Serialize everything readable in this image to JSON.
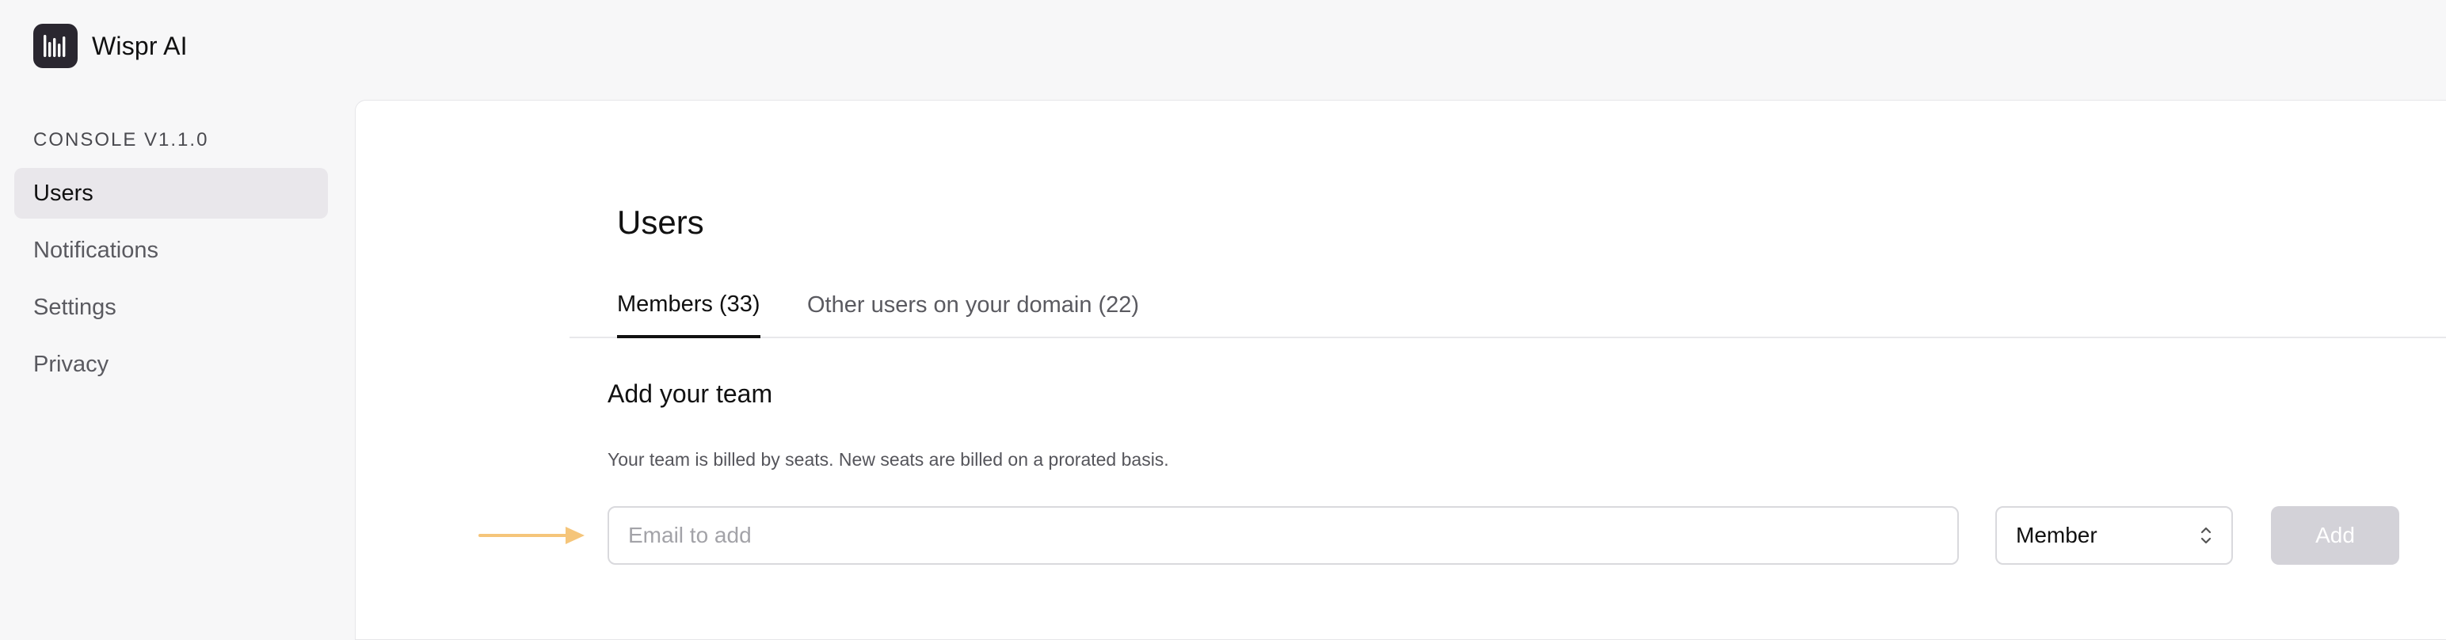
{
  "brand": {
    "name": "Wispr AI",
    "logo_icon": "equalizer-bars-icon"
  },
  "sidebar": {
    "version_label": "CONSOLE V1.1.0",
    "items": [
      {
        "label": "Users",
        "active": true
      },
      {
        "label": "Notifications",
        "active": false
      },
      {
        "label": "Settings",
        "active": false
      },
      {
        "label": "Privacy",
        "active": false
      }
    ]
  },
  "main": {
    "title": "Users",
    "tabs": [
      {
        "label": "Members (33)",
        "active": true
      },
      {
        "label": "Other users on your domain (22)",
        "active": false
      }
    ],
    "add_team": {
      "title": "Add your team",
      "description": "Your team is billed by seats. New seats are billed on a prorated basis.",
      "email_placeholder": "Email to add",
      "email_value": "",
      "role_selected": "Member",
      "add_label": "Add"
    }
  },
  "annotation": {
    "arrow_icon": "right-arrow-icon",
    "arrow_color": "#f5c57a"
  },
  "colors": {
    "background": "#f7f7f8",
    "panel": "#ffffff",
    "active_nav": "#e9e7eb",
    "add_button_disabled": "#d3d2d8",
    "logo": "#2a2730"
  }
}
